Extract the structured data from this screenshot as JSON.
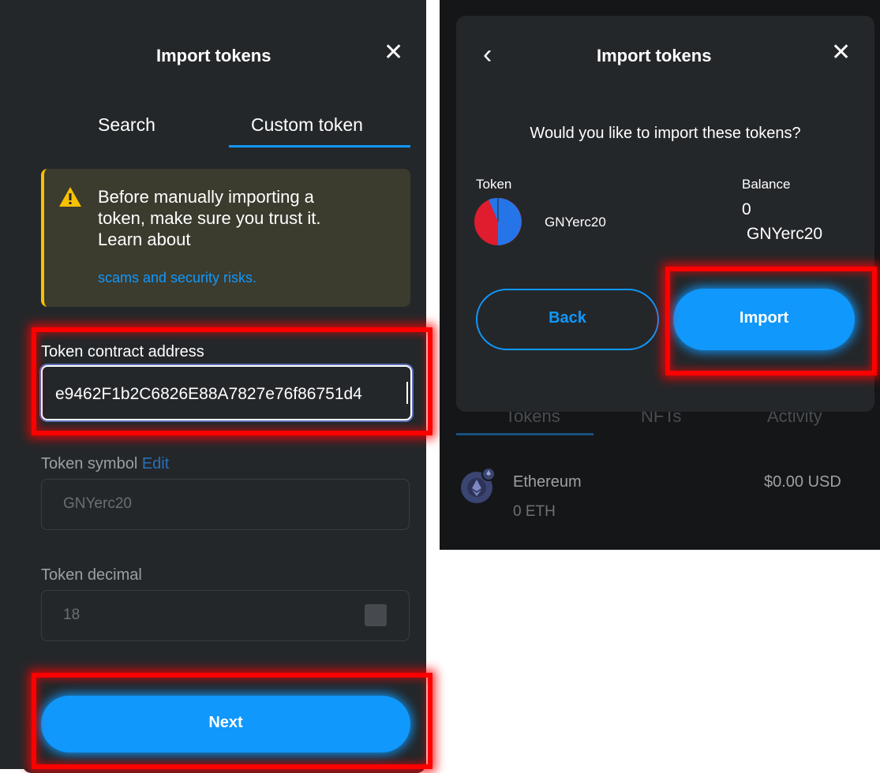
{
  "left": {
    "title": "Import tokens",
    "tabs": [
      {
        "label": "Search",
        "active": false
      },
      {
        "label": "Custom token",
        "active": true
      }
    ],
    "warning": {
      "line1": "Before manually importing a",
      "line2": "token, make sure you trust it.",
      "line3": "Learn about",
      "link": "scams and security risks."
    },
    "address": {
      "label": "Token contract address",
      "value": "e9462F1b2C6826E88A7827e76f86751d4"
    },
    "symbol": {
      "label": "Token symbol",
      "edit": "Edit",
      "value": "GNYerc20"
    },
    "decimal": {
      "label": "Token decimal",
      "value": "18"
    },
    "next_label": "Next"
  },
  "right": {
    "title": "Import tokens",
    "question": "Would you like to import these tokens?",
    "token_header": "Token",
    "balance_header": "Balance",
    "token_name": "GNYerc20",
    "balance_amount": "0",
    "balance_symbol": "GNYerc20",
    "back_label": "Back",
    "import_label": "Import",
    "background_tabs": [
      "Tokens",
      "NFTs",
      "Activity"
    ],
    "asset": {
      "name": "Ethereum",
      "amount": "0 ETH",
      "usd": "$0.00 USD"
    }
  },
  "colors": {
    "accent": "#1098fc",
    "panel": "#24272a",
    "highlight": "#ff0000",
    "warning": "#f8c000"
  },
  "icons": [
    "close-icon",
    "back-chevron-icon",
    "warning-icon",
    "token-pie-icon",
    "ethereum-icon"
  ]
}
